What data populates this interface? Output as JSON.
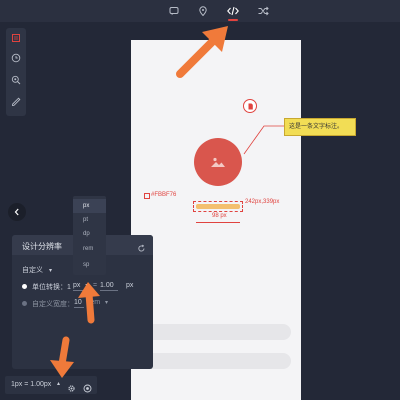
{
  "toolbar": {
    "icons": [
      "comment-icon",
      "location-pin-icon",
      "code-icon",
      "shuffle-icon"
    ],
    "accent_color": "#e0433f"
  },
  "sidebar": {
    "icons": [
      "layers-icon",
      "clock-icon",
      "zoom-icon",
      "eyedropper-icon"
    ]
  },
  "canvas": {
    "annotation_text": "这是一条文字标注。",
    "color_label": "#FBBF76",
    "size_label": "242px,339px",
    "width_label": "98 px",
    "avatar_color": "#d9564d",
    "bar_color": "#f3c06f"
  },
  "resolution_panel": {
    "title": "设计分辨率",
    "preset": "自定义",
    "unit_conversion_label": "单位转换：1",
    "unit_value": "px",
    "arrow": "=",
    "ratio_value": "1.00",
    "target_unit": "px",
    "custom_width_label": "自定义宽度：",
    "custom_width_value": "10",
    "custom_width_unit": "rem"
  },
  "unit_dropdown": {
    "options": [
      "px",
      "pt",
      "dp",
      "rem",
      "sp"
    ],
    "selected": "px"
  },
  "bottom_bar": {
    "scale_label": "1px = 1.00px"
  }
}
